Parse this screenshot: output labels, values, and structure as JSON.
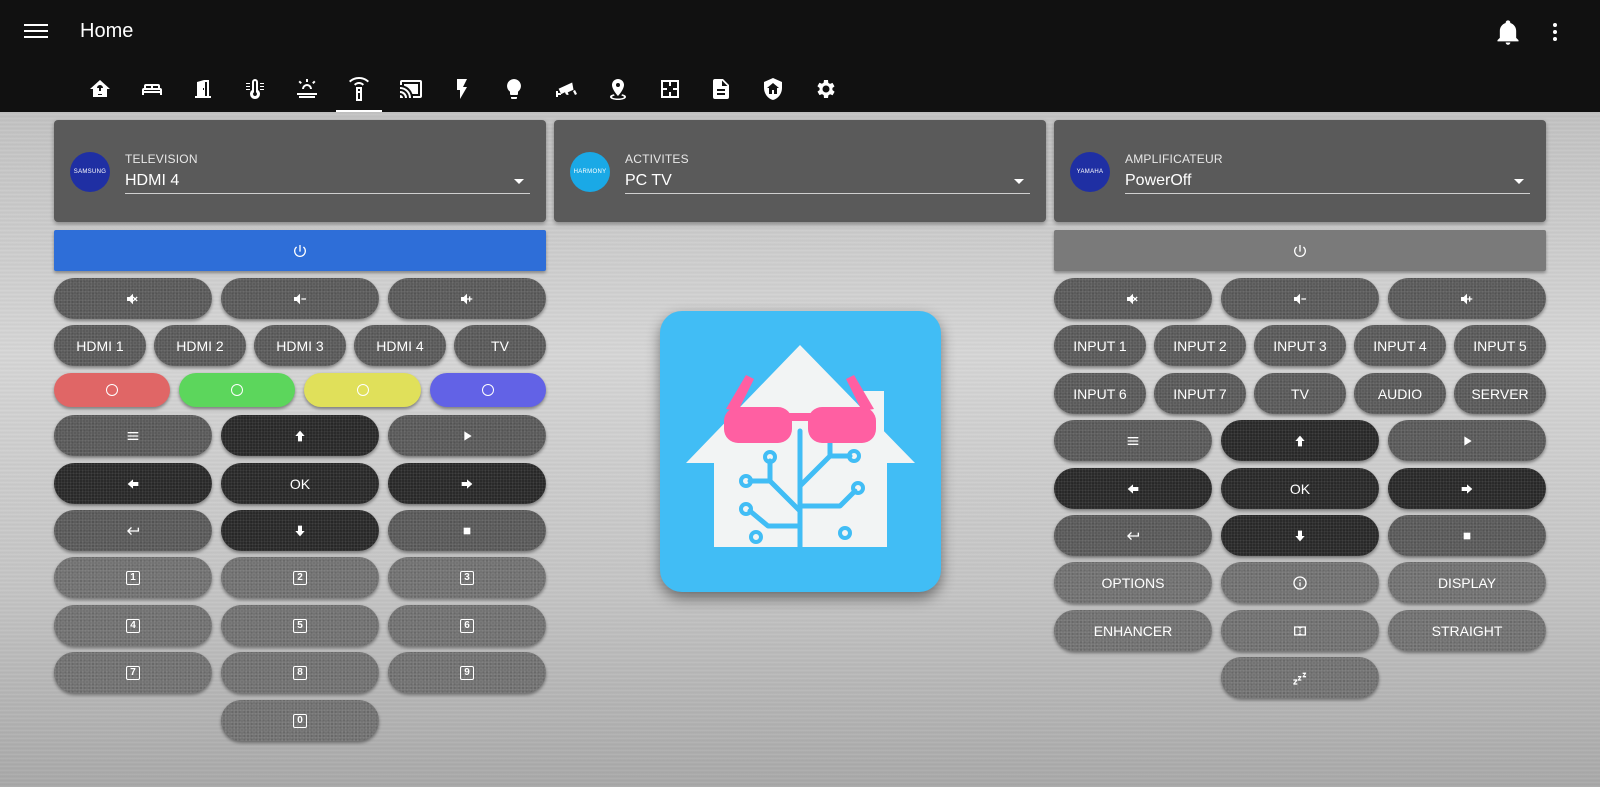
{
  "app": {
    "title": "Home"
  },
  "header_icons": [
    "menu-icon",
    "bell-icon",
    "kebab-icon"
  ],
  "tabs": [
    {
      "icon": "home-automation-icon"
    },
    {
      "icon": "sofa-icon"
    },
    {
      "icon": "door-icon"
    },
    {
      "icon": "thermometer-icon"
    },
    {
      "icon": "weather-icon"
    },
    {
      "icon": "remote-icon",
      "active": true
    },
    {
      "icon": "cast-icon"
    },
    {
      "icon": "flash-icon"
    },
    {
      "icon": "lightbulb-icon"
    },
    {
      "icon": "cctv-icon"
    },
    {
      "icon": "map-marker-icon"
    },
    {
      "icon": "floor-plan-icon"
    },
    {
      "icon": "document-icon"
    },
    {
      "icon": "shield-home-icon"
    },
    {
      "icon": "gear-icon"
    }
  ],
  "selectors": {
    "television": {
      "logo": "SAMSUNG",
      "label": "TELEVISION",
      "value": "HDMI 4",
      "logo_color": "#1f2fa3"
    },
    "activites": {
      "logo": "HARMONY",
      "label": "ACTIVITES",
      "value": "PC TV",
      "logo_color": "#1aa9e6"
    },
    "amplificateur": {
      "logo": "YAMAHA",
      "label": "AMPLIFICATEUR",
      "value": "PowerOff",
      "logo_color": "#1f2fa3"
    }
  },
  "tv_remote": {
    "power_color": "#2e6ed8",
    "volume": [
      "mute-icon",
      "volume-down-icon",
      "volume-up-icon"
    ],
    "inputs": [
      "HDMI 1",
      "HDMI 2",
      "HDMI 3",
      "HDMI 4",
      "TV"
    ],
    "color_buttons": [
      {
        "name": "red",
        "color": "#e06666"
      },
      {
        "name": "green",
        "color": "#5cd65c"
      },
      {
        "name": "yellow",
        "color": "#e0e05a"
      },
      {
        "name": "blue",
        "color": "#6262e6"
      }
    ],
    "ok_label": "OK",
    "digits": [
      "1",
      "2",
      "3",
      "4",
      "5",
      "6",
      "7",
      "8",
      "9",
      "0"
    ]
  },
  "amp_remote": {
    "power_color": "#7a7a7a",
    "volume": [
      "mute-icon",
      "volume-down-icon",
      "volume-up-icon"
    ],
    "inputs_row1": [
      "INPUT 1",
      "INPUT 2",
      "INPUT 3",
      "INPUT 4",
      "INPUT 5"
    ],
    "inputs_row2": [
      "INPUT 6",
      "INPUT 7",
      "TV",
      "AUDIO",
      "SERVER"
    ],
    "ok_label": "OK",
    "options_label": "OPTIONS",
    "display_label": "DISPLAY",
    "enhancer_label": "ENHANCER",
    "straight_label": "STRAIGHT"
  },
  "center_logo": {
    "icon": "home-assistant-logo-icon",
    "bg_color": "#41bdf5"
  }
}
